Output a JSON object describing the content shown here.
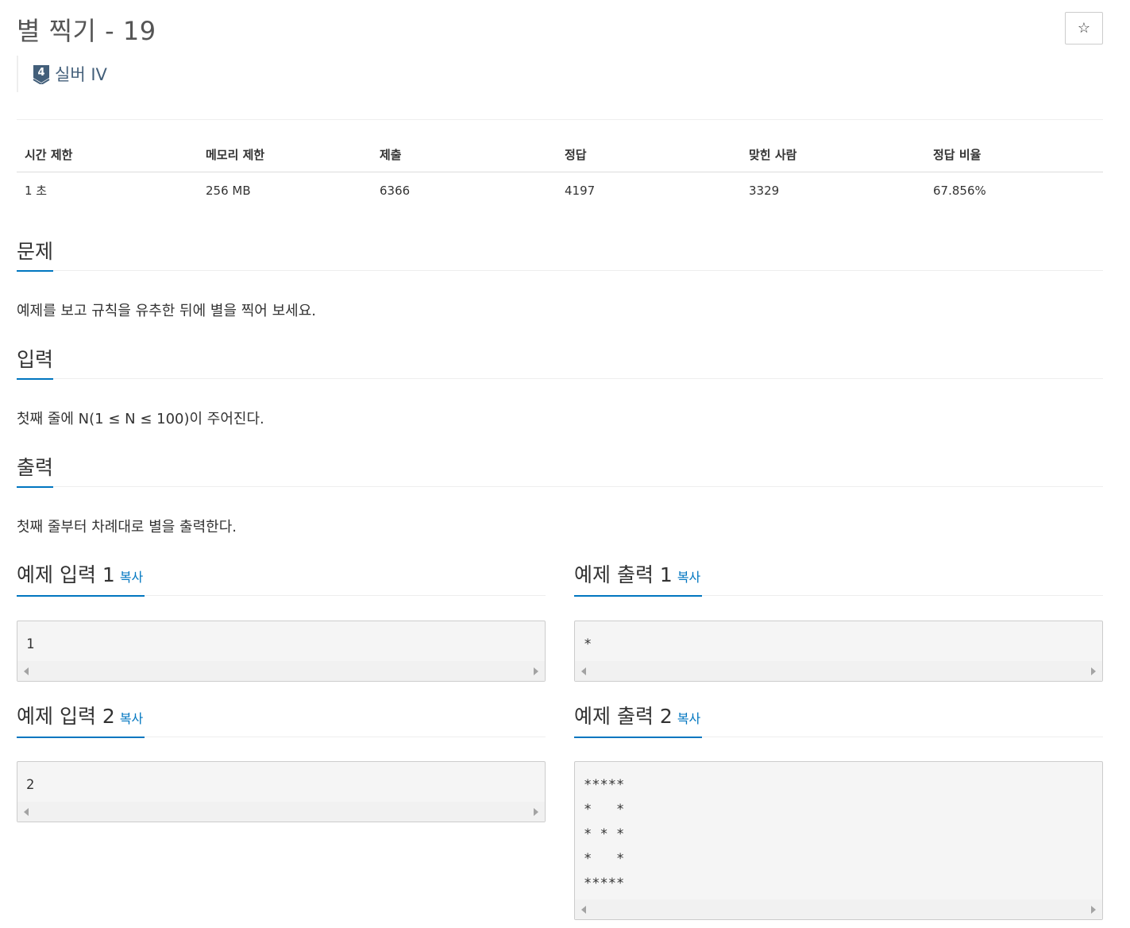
{
  "problem": {
    "title": "별 찍기 - 19",
    "star_icon": "☆",
    "tier": {
      "level": "4",
      "label": "실버 IV",
      "color": "#435f7a"
    }
  },
  "info_table": {
    "headers": [
      "시간 제한",
      "메모리 제한",
      "제출",
      "정답",
      "맞힌 사람",
      "정답 비율"
    ],
    "values": [
      "1 초",
      "256 MB",
      "6366",
      "4197",
      "3329",
      "67.856%"
    ]
  },
  "sections": {
    "problem": {
      "title": "문제",
      "body": "예제를 보고 규칙을 유추한 뒤에 별을 찍어 보세요."
    },
    "input": {
      "title": "입력",
      "body": "첫째 줄에 N(1 ≤ N ≤ 100)이 주어진다."
    },
    "output": {
      "title": "출력",
      "body": "첫째 줄부터 차례대로 별을 출력한다."
    }
  },
  "examples": [
    {
      "title": "예제 입력 1",
      "copy": "복사",
      "content": "1"
    },
    {
      "title": "예제 출력 1",
      "copy": "복사",
      "content": "*"
    },
    {
      "title": "예제 입력 2",
      "copy": "복사",
      "content": "2"
    },
    {
      "title": "예제 출력 2",
      "copy": "복사",
      "content": "*****\n*   *\n* * *\n*   *\n*****"
    }
  ],
  "colors": {
    "accent": "#0076c0",
    "tier_silver": "#435f7a"
  }
}
